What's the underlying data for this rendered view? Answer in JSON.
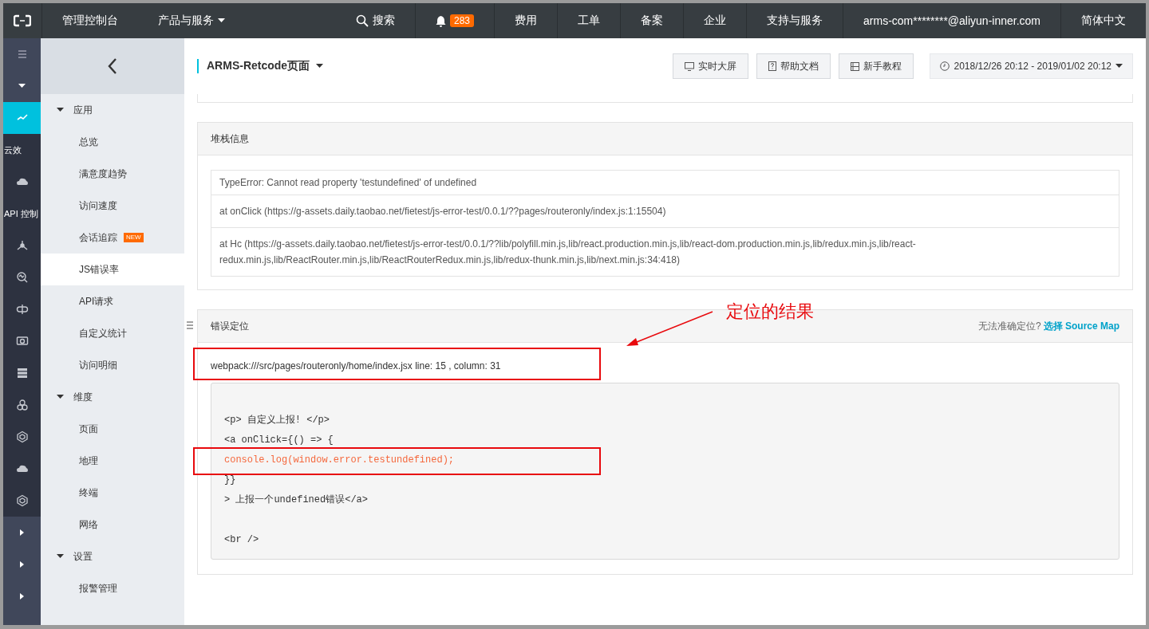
{
  "topbar": {
    "console": "管理控制台",
    "products": "产品与服务",
    "search": "搜索",
    "notifications": "283",
    "links": [
      "费用",
      "工单",
      "备案",
      "企业",
      "支持与服务"
    ],
    "account": "arms-com********@aliyun-inner.com",
    "language": "简体中文"
  },
  "rail": {
    "items": [
      {
        "kind": "icon",
        "selected": true
      },
      {
        "kind": "label",
        "label": "云效"
      },
      {
        "kind": "icon",
        "selected": false
      },
      {
        "kind": "label",
        "label": "API 控制"
      },
      {
        "kind": "icon",
        "selected": false
      },
      {
        "kind": "icon",
        "selected": false
      },
      {
        "kind": "icon",
        "selected": false
      },
      {
        "kind": "icon",
        "selected": false
      },
      {
        "kind": "icon",
        "selected": false
      },
      {
        "kind": "icon",
        "selected": false
      },
      {
        "kind": "icon",
        "selected": false
      },
      {
        "kind": "icon",
        "selected": false
      },
      {
        "kind": "icon",
        "selected": false
      }
    ]
  },
  "sidebar": {
    "groups": [
      {
        "label": "应用",
        "expanded": true,
        "children": [
          {
            "label": "总览",
            "selected": false
          },
          {
            "label": "满意度趋势",
            "selected": false
          },
          {
            "label": "访问速度",
            "selected": false
          },
          {
            "label": "会话追踪",
            "selected": false,
            "badge": "NEW"
          },
          {
            "label": "JS错误率",
            "selected": true
          },
          {
            "label": "API请求",
            "selected": false
          },
          {
            "label": "自定义统计",
            "selected": false
          },
          {
            "label": "访问明细",
            "selected": false
          }
        ]
      },
      {
        "label": "维度",
        "expanded": true,
        "children": [
          {
            "label": "页面",
            "selected": false
          },
          {
            "label": "地理",
            "selected": false
          },
          {
            "label": "终端",
            "selected": false
          },
          {
            "label": "网络",
            "selected": false
          }
        ]
      },
      {
        "label": "设置",
        "expanded": true,
        "children": [
          {
            "label": "报警管理",
            "selected": false
          }
        ]
      }
    ]
  },
  "header": {
    "title": "ARMS-Retcode页面",
    "buttons": [
      "实时大屏",
      "帮助文档",
      "新手教程"
    ],
    "date_range": "2018/12/26 20:12 - 2019/01/02 20:12"
  },
  "stack_panel": {
    "title": "堆栈信息",
    "lines": [
      "TypeError: Cannot read property 'testundefined' of undefined",
      "at onClick (https://g-assets.daily.taobao.net/fietest/js-error-test/0.0.1/??pages/routeronly/index.js:1:15504)",
      "at Hc (https://g-assets.daily.taobao.net/fietest/js-error-test/0.0.1/??lib/polyfill.min.js,lib/react.production.min.js,lib/react-dom.production.min.js,lib/redux.min.js,lib/react-redux.min.js,lib/ReactRouter.min.js,lib/ReactRouterRedux.min.js,lib/redux-thunk.min.js,lib/next.min.js:34:418)"
    ]
  },
  "location_panel": {
    "title": "错误定位",
    "hint": "无法准确定位?",
    "link": "选择 Source Map",
    "location": "webpack:///src/pages/routeronly/home/index.jsx line: 15 , column: 31",
    "code_lines": [
      {
        "text": "<p> 自定义上报! </p>",
        "highlighted": false
      },
      {
        "text": "<a onClick={() => {",
        "highlighted": false
      },
      {
        "text": "console.log(window.error.testundefined);",
        "highlighted": true
      },
      {
        "text": "}}",
        "highlighted": false
      },
      {
        "text": "> 上报一个undefined错误</a>",
        "highlighted": false
      },
      {
        "highlighted": false
      },
      {
        "text": "<br />",
        "highlighted": false
      }
    ]
  },
  "annotation": {
    "text": "定位的结果"
  }
}
